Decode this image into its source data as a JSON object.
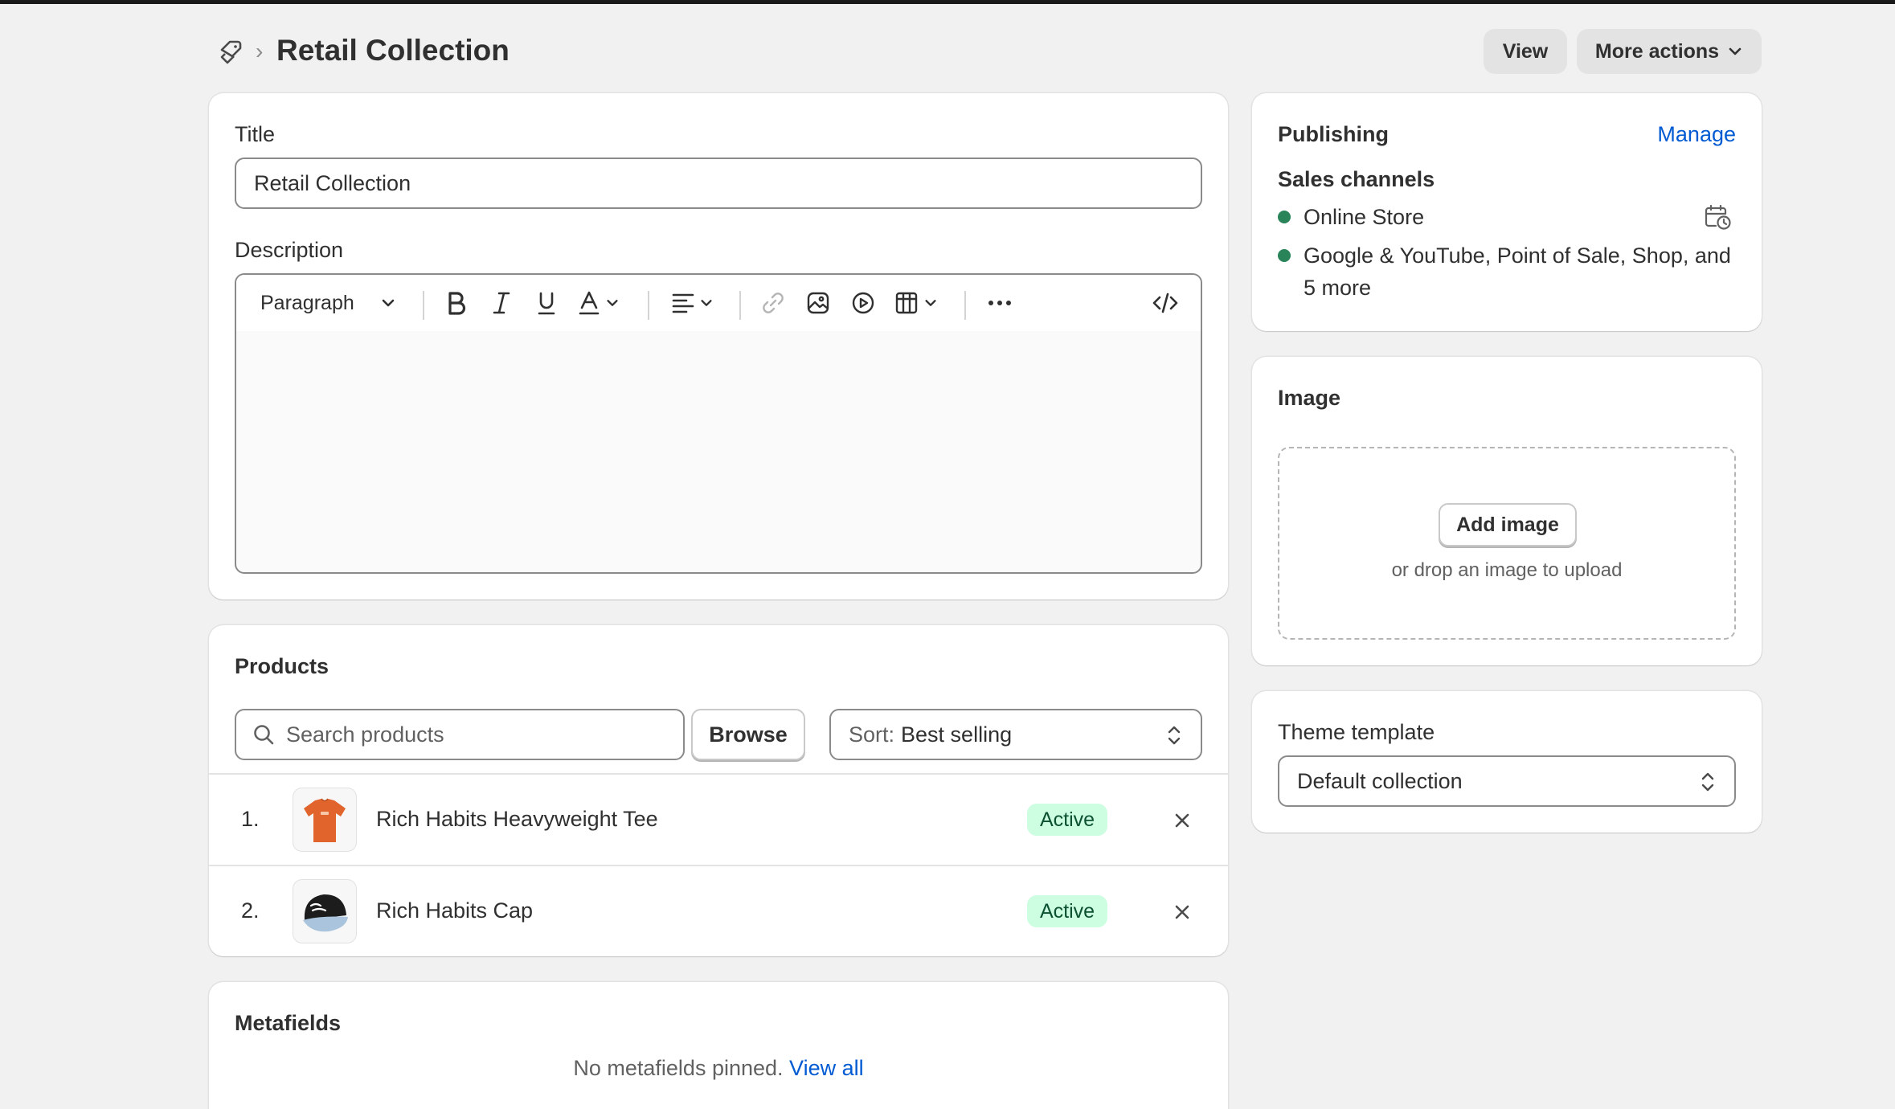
{
  "header": {
    "breadcrumb_icon": "collection-tag-icon",
    "title": "Retail Collection",
    "view_label": "View",
    "more_actions_label": "More actions"
  },
  "main": {
    "title_label": "Title",
    "title_value": "Retail Collection",
    "description_label": "Description",
    "toolbar": {
      "format_label": "Paragraph"
    }
  },
  "products": {
    "heading": "Products",
    "search_placeholder": "Search products",
    "browse_label": "Browse",
    "sort_prefix": "Sort:",
    "sort_value": "Best selling",
    "items": [
      {
        "index": "1.",
        "name": "Rich Habits Heavyweight Tee",
        "status": "Active",
        "thumb": "orange-tshirt"
      },
      {
        "index": "2.",
        "name": "Rich Habits Cap",
        "status": "Active",
        "thumb": "black-cap"
      }
    ]
  },
  "metafields": {
    "heading": "Metafields",
    "empty_text": "No metafields pinned.",
    "view_all_label": "View all"
  },
  "publishing": {
    "heading": "Publishing",
    "manage_label": "Manage",
    "sales_channels_label": "Sales channels",
    "channels": [
      "Online Store",
      "Google & YouTube, Point of Sale, Shop, and",
      "5 more"
    ]
  },
  "image": {
    "heading": "Image",
    "add_label": "Add image",
    "hint": "or drop an image to upload"
  },
  "theme": {
    "label": "Theme template",
    "value": "Default collection"
  },
  "colors": {
    "accent_link": "#005bd3",
    "status_active_bg": "#cdfee1",
    "status_active_text": "#0c5132",
    "channel_dot": "#29845a"
  }
}
